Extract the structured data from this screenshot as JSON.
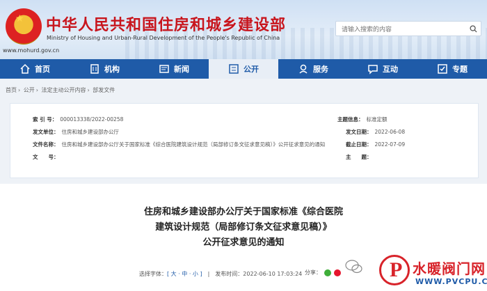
{
  "header": {
    "title_cn": "中华人民共和国住房和城乡建设部",
    "title_en": "Ministry of Housing and Urban-Rural Development of the People's Republic of China",
    "site_url": "www.mohurd.gov.cn",
    "search_placeholder": "请输入搜索的内容"
  },
  "nav": [
    {
      "label": "首页",
      "icon": "home-icon"
    },
    {
      "label": "机构",
      "icon": "building-icon"
    },
    {
      "label": "新闻",
      "icon": "news-icon"
    },
    {
      "label": "公开",
      "icon": "open-icon"
    },
    {
      "label": "服务",
      "icon": "service-icon"
    },
    {
      "label": "互动",
      "icon": "chat-icon"
    },
    {
      "label": "专题",
      "icon": "topic-icon"
    }
  ],
  "breadcrumb": [
    "首页",
    "公开",
    "法定主动公开内容",
    "部发文件"
  ],
  "meta": {
    "index_label": "索 引 号：",
    "index_value": "000013338/2022-00258",
    "subject_label": "主题信息：",
    "subject_value": "标准定额",
    "org_label": "发文单位：",
    "org_value": "住房和城乡建设部办公厅",
    "date_label": "发文日期：",
    "date_value": "2022-06-08",
    "name_label": "文件名称：",
    "name_value": "住房和城乡建设部办公厅关于国家标准《综合医院建筑设计规范（局部修订条文征求意见稿）》公开征求意见的通知",
    "deadline_label": "截止日期：",
    "deadline_value": "2022-07-09",
    "docno_label": "文　　号：",
    "docno_value": "",
    "topic_label": "主　　题：",
    "topic_value": ""
  },
  "article": {
    "title_line1": "住房和城乡建设部办公厅关于国家标准《综合医院",
    "title_line2": "建筑设计规范（局部修订条文征求意见稿）》",
    "title_line3": "公开征求意见的通知",
    "font_label": "选择字体：",
    "font_options": "[ 大 · 中 · 小 ]",
    "publish_label": "发布时间：",
    "publish_value": "2022-06-10 17:03:24",
    "share_label": "分享："
  },
  "watermark": {
    "text": "水暖阀门网",
    "url": "WWW.PVCPU.COM"
  },
  "colors": {
    "brand_red": "#c8151d",
    "nav_blue": "#1f5ba8"
  }
}
